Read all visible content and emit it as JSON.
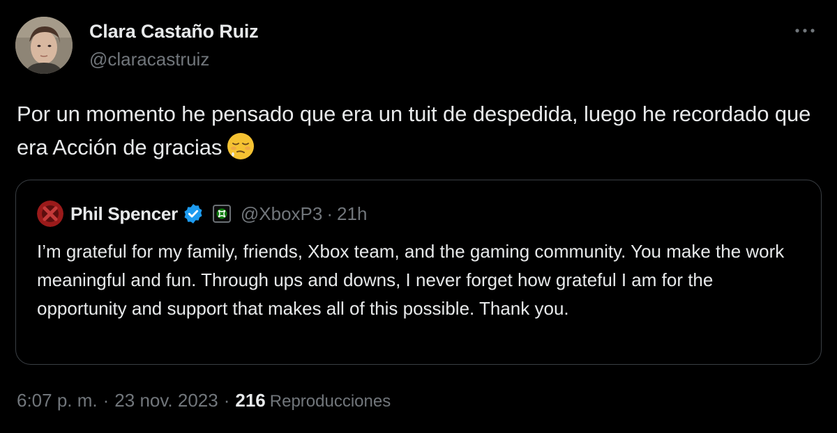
{
  "author": {
    "display_name": "Clara Castaño Ruiz",
    "handle": "@claracastruiz"
  },
  "tweet": {
    "text": "Por un momento he pensado que era un tuit de despedida, luego he recordado que era Acción de gracias",
    "emoji": "relieved-face-emoji"
  },
  "quoted": {
    "display_name": "Phil Spencer",
    "handle": "@XboxP3",
    "separator": "·",
    "time": "21h",
    "text": "I’m grateful for my family, friends, Xbox team, and the gaming community. You make the work meaningful and fun. Through ups and downs, I never forget how grateful I am for the opportunity and support that makes all of this possible. Thank you."
  },
  "meta": {
    "time": "6:07 p. m.",
    "separator": "·",
    "date": "23 nov. 2023",
    "views_count": "216",
    "views_label": "Reproducciones"
  },
  "colors": {
    "background": "#000000",
    "primary_text": "#e7e9ea",
    "secondary_text": "#71767b",
    "verified_blue": "#1d9bf0",
    "xbox_green": "#107c10",
    "border": "#3a3f44"
  },
  "icons": [
    "more-options-icon",
    "verified-badge-icon",
    "xbox-affiliate-icon"
  ]
}
